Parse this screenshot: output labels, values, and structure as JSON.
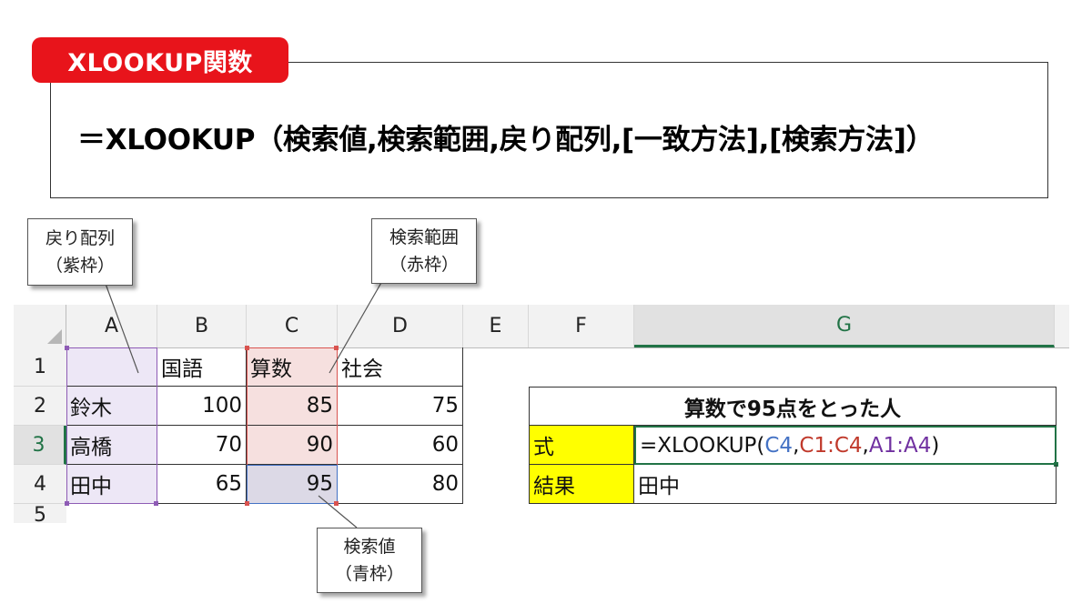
{
  "header": {
    "badge": "XLOOKUP関数",
    "syntax": "＝XLOOKUP（検索値,検索範囲,戻り配列,[一致方法],[検索方法]）"
  },
  "callouts": {
    "return_array": {
      "line1": "戻り配列",
      "line2": "（紫枠）"
    },
    "lookup_array": {
      "line1": "検索範囲",
      "line2": "（赤枠）"
    },
    "lookup_value": {
      "line1": "検索値",
      "line2": "（青枠）"
    }
  },
  "sheet": {
    "columns": [
      "A",
      "B",
      "C",
      "D",
      "E",
      "F",
      "G"
    ],
    "selected_column": "G",
    "rows": [
      "1",
      "2",
      "3",
      "4",
      "5"
    ],
    "selected_row": "3",
    "table": {
      "headers": [
        "",
        "国語",
        "算数",
        "社会"
      ],
      "data": [
        [
          "鈴木",
          "100",
          "85",
          "75"
        ],
        [
          "高橋",
          "70",
          "90",
          "60"
        ],
        [
          "田中",
          "65",
          "95",
          "80"
        ]
      ]
    },
    "result_box": {
      "title": "算数で95点をとった人",
      "formula_label": "式",
      "formula": {
        "prefix": "=XLOOKUP(",
        "arg1": "C4",
        "sep1": ",",
        "arg2": "C1:C4",
        "sep2": ",",
        "arg3": "A1:A4",
        "suffix": ")"
      },
      "result_label": "結果",
      "result_value": "田中"
    }
  },
  "colors": {
    "badge": "#e8141b",
    "purple_frame": "#8e5bb5",
    "red_frame": "#d9534f",
    "blue_frame": "#4472c4",
    "label_fill": "#ffff00",
    "excel_green": "#217346"
  }
}
